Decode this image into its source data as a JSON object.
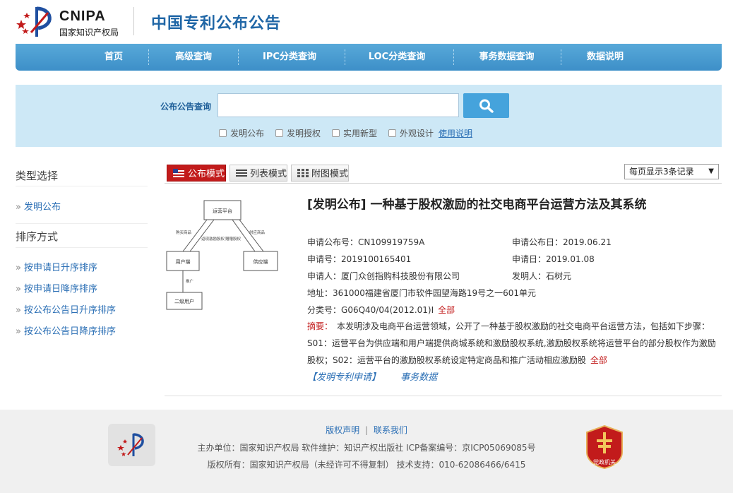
{
  "header": {
    "logo_en": "CNIPA",
    "logo_cn": "国家知识产权局",
    "site_title": "中国专利公布公告"
  },
  "nav": {
    "items": [
      "首页",
      "高级查询",
      "IPC分类查询",
      "LOC分类查询",
      "事务数据查询",
      "数据说明"
    ]
  },
  "search": {
    "label": "公布公告查询",
    "value": "",
    "checkboxes": [
      {
        "label": "发明公布",
        "checked": false
      },
      {
        "label": "发明授权",
        "checked": false
      },
      {
        "label": "实用新型",
        "checked": false
      },
      {
        "label": "外观设计",
        "checked": false
      }
    ],
    "help_link": "使用说明"
  },
  "sidebar": {
    "type_title": "类型选择",
    "type_items": [
      "发明公布"
    ],
    "sort_title": "排序方式",
    "sort_items": [
      "按申请日升序排序",
      "按申请日降序排序",
      "按公布公告日升序排序",
      "按公布公告日降序排序"
    ],
    "arrow": "»"
  },
  "toolbar": {
    "modes": [
      "公布模式",
      "列表模式",
      "附图模式"
    ],
    "active_mode": "公布模式",
    "per_page": "每页显示3条记录",
    "per_page_caret": "▼"
  },
  "record": {
    "title": "[发明公布] 一种基于股权激励的社交电商平台运营方法及其系统",
    "pub_no_label": "申请公布号：",
    "pub_no": "CN109919759A",
    "pub_date_label": "申请公布日：",
    "pub_date": "2019.06.21",
    "app_no_label": "申请号：",
    "app_no": "2019100165401",
    "app_date_label": "申请日：",
    "app_date": "2019.01.08",
    "applicant_label": "申请人：",
    "applicant": "厦门众创指购科技股份有限公司",
    "inventor_label": "发明人：",
    "inventor": "石树元",
    "address_label": "地址：",
    "address": "361000福建省厦门市软件园望海路19号之一601单元",
    "class_label": "分类号：",
    "class_no": "G06Q40/04(2012.01)I",
    "class_all": "全部",
    "abstract_label": "摘要：",
    "abstract": "本发明涉及电商平台运营领域，公开了一种基于股权激励的社交电商平台运营方法，包括如下步骤：S01：运营平台为供应端和用户端提供商城系统和激励股权系统,激励股权系统将运营平台的部分股权作为激励股权；S02：运营平台的激励股权系统设定特定商品和推广活动相应激励股",
    "abstract_all": "全部",
    "link_apply": "【发明专利申请】",
    "link_affairs": "事务数据",
    "diagram": {
      "top": "运营平台",
      "left": "用户端",
      "right": "供应端",
      "bottom": "二级用户",
      "edge_buy": "购买商品",
      "edge_mid": "返现激励股权",
      "edge_right_in": "赠赠股权",
      "edge_supply": "供应商品",
      "edge_promo": "推广"
    }
  },
  "footer": {
    "link_copyright": "版权声明",
    "link_sep": "|",
    "link_contact": "联系我们",
    "line1": "主办单位：国家知识产权局    软件维护：知识产权出版社    ICP备案编号：京ICP05069085号",
    "line2": "版权所有：国家知识产权局（未经许可不得复制）    技术支持：010-62086466/6415",
    "badge_text": "党政机关"
  },
  "colors": {
    "nav_blue": "#3d8fc8",
    "panel_blue": "#cde8f6",
    "accent_red": "#c21b1b",
    "link_blue": "#2b6fb5",
    "title_blue": "#1f66a6"
  }
}
